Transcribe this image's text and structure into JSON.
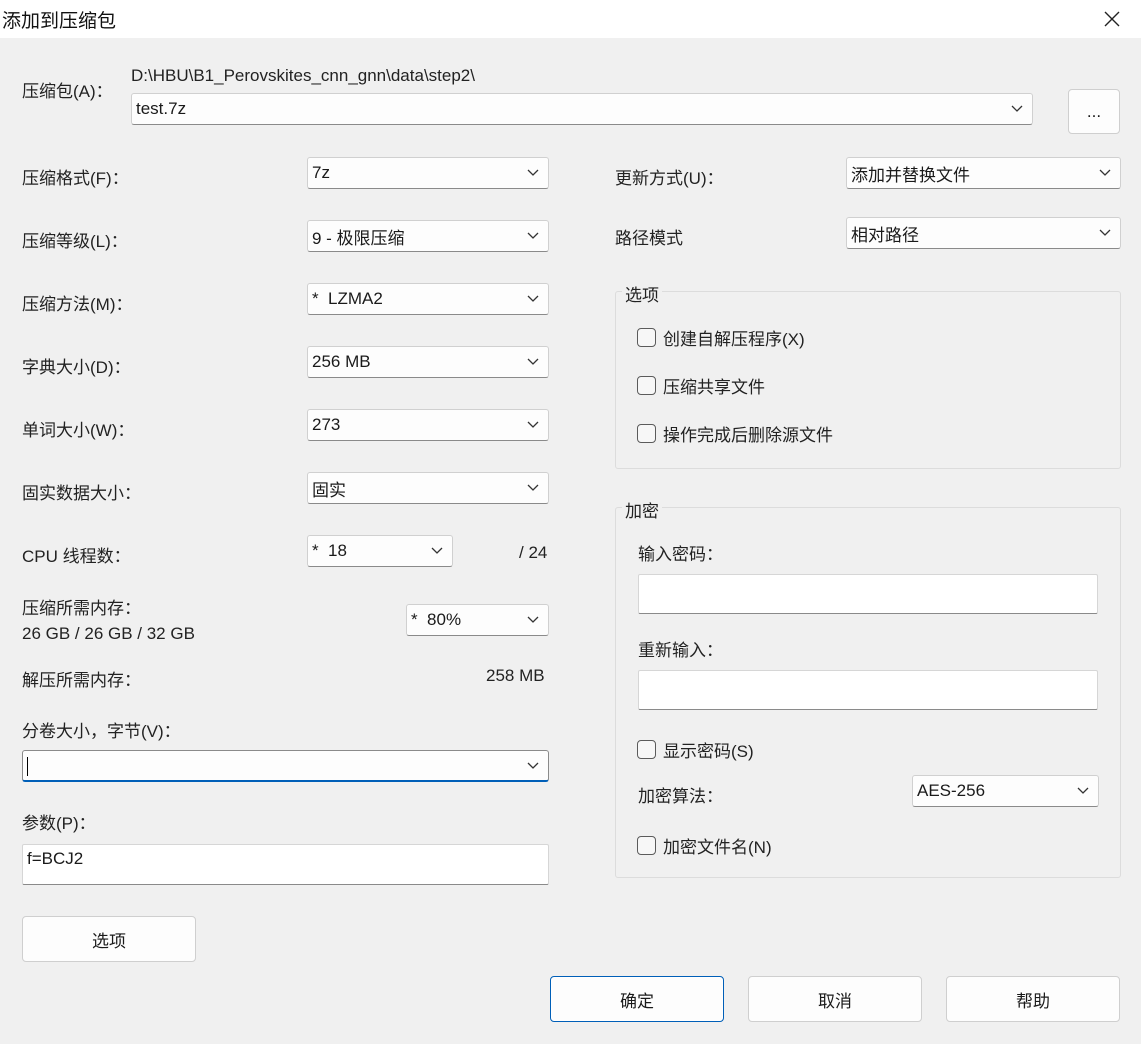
{
  "window": {
    "title": "添加到压缩包"
  },
  "archive": {
    "label": "压缩包(A)：",
    "path": "D:\\HBU\\B1_Perovskites_cnn_gnn\\data\\step2\\",
    "name": "test.7z",
    "browse_label": "..."
  },
  "left": {
    "format": {
      "label": "压缩格式(F)：",
      "value": "7z"
    },
    "level": {
      "label": "压缩等级(L)：",
      "value": "9 - 极限压缩"
    },
    "method": {
      "label": "压缩方法(M)：",
      "value": "*  LZMA2"
    },
    "dict": {
      "label": "字典大小(D)：",
      "value": "256 MB"
    },
    "word": {
      "label": "单词大小(W)：",
      "value": "273"
    },
    "solid": {
      "label": "固实数据大小：",
      "value": "固实"
    },
    "threads": {
      "label": "CPU 线程数：",
      "value": "*  18",
      "total": "/ 24"
    },
    "mem_compress": {
      "label": "压缩所需内存：",
      "detail": "26 GB / 26 GB / 32 GB",
      "value": "*  80%"
    },
    "mem_decompress": {
      "label": "解压所需内存：",
      "value": "258 MB"
    },
    "volume": {
      "label": "分卷大小，字节(V)：",
      "value": ""
    },
    "params": {
      "label": "参数(P)：",
      "value": "f=BCJ2"
    },
    "options_button": "选项"
  },
  "right": {
    "update": {
      "label": "更新方式(U)：",
      "value": "添加并替换文件"
    },
    "pathmode": {
      "label": "路径模式",
      "value": "相对路径"
    },
    "options_group": {
      "title": "选项",
      "sfx": "创建自解压程序(X)",
      "shared": "压缩共享文件",
      "delete": "操作完成后删除源文件"
    },
    "encryption": {
      "title": "加密",
      "password_label": "输入密码：",
      "reenter_label": "重新输入：",
      "show_password": "显示密码(S)",
      "method_label": "加密算法：",
      "method_value": "AES-256",
      "encrypt_names": "加密文件名(N)"
    }
  },
  "buttons": {
    "ok": "确定",
    "cancel": "取消",
    "help": "帮助"
  },
  "icons": {
    "close": "close-icon",
    "dropdown": "chevron-down-icon"
  },
  "colors": {
    "accent": "#005fb8",
    "background": "#f0f0f0"
  }
}
